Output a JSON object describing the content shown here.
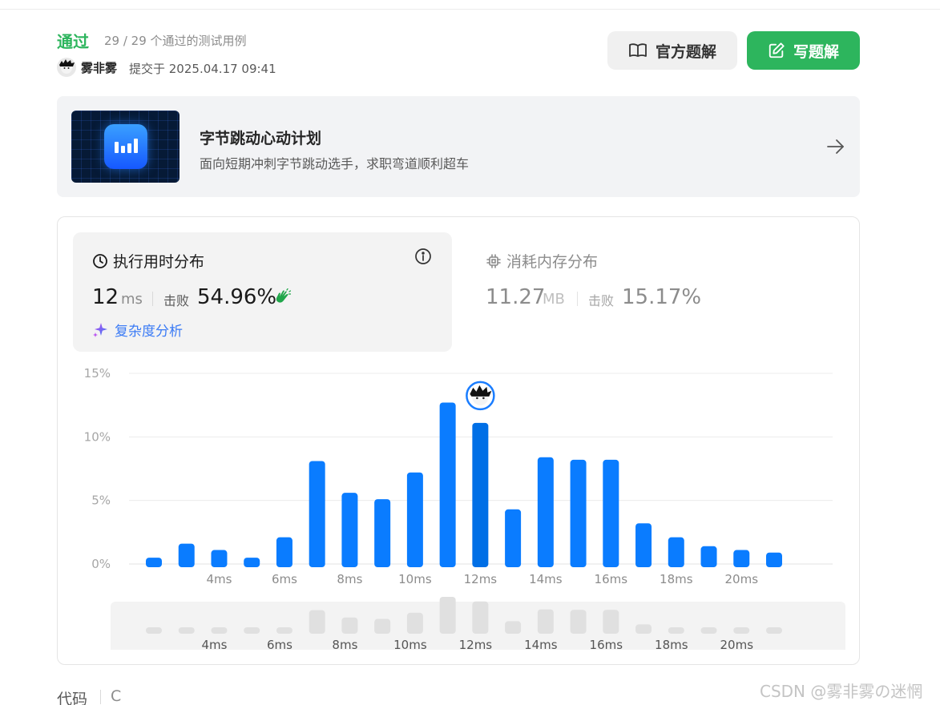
{
  "result": {
    "status": "通过",
    "cases_text": "29 / 29 个通过的测试用例",
    "username": "雾非雾",
    "submitted_text": "提交于 2025.04.17 09:41"
  },
  "actions": {
    "official_solution": "官方题解",
    "write_solution": "写题解"
  },
  "banner": {
    "title": "字节跳动心动计划",
    "subtitle": "面向短期冲刺字节跳动选手，求职弯道顺利超车"
  },
  "runtime": {
    "title": "执行用时分布",
    "value": "12",
    "unit": "ms",
    "beats_label": "击败",
    "beats_pct": "54.96%",
    "complexity_link": "复杂度分析"
  },
  "memory": {
    "title": "消耗内存分布",
    "value": "11.27",
    "unit": "MB",
    "beats_label": "击败",
    "beats_pct": "15.17%"
  },
  "chart_data": {
    "type": "bar",
    "x": [
      2,
      3,
      4,
      5,
      6,
      7,
      8,
      9,
      10,
      11,
      12,
      13,
      14,
      15,
      16,
      17,
      18,
      19,
      20,
      21
    ],
    "values": [
      0.5,
      1.6,
      1.1,
      0.5,
      2.1,
      8.1,
      5.6,
      5.1,
      7.2,
      12.7,
      11.1,
      4.3,
      8.4,
      8.2,
      8.2,
      3.2,
      2.1,
      1.4,
      1.1,
      0.9
    ],
    "highlight_x": 12,
    "y_ticks": [
      "0%",
      "5%",
      "10%",
      "15%"
    ],
    "x_ticks": [
      "4ms",
      "6ms",
      "8ms",
      "10ms",
      "12ms",
      "14ms",
      "16ms",
      "18ms",
      "20ms"
    ],
    "ylim": [
      0,
      15
    ],
    "grid": true,
    "colors": {
      "bar": "#0a7cff",
      "highlight": "#006fe6",
      "nav_bar": "#e0e0e0"
    }
  },
  "code": {
    "label": "代码",
    "language": "C"
  },
  "watermark": "CSDN @雾非雾の迷惘"
}
